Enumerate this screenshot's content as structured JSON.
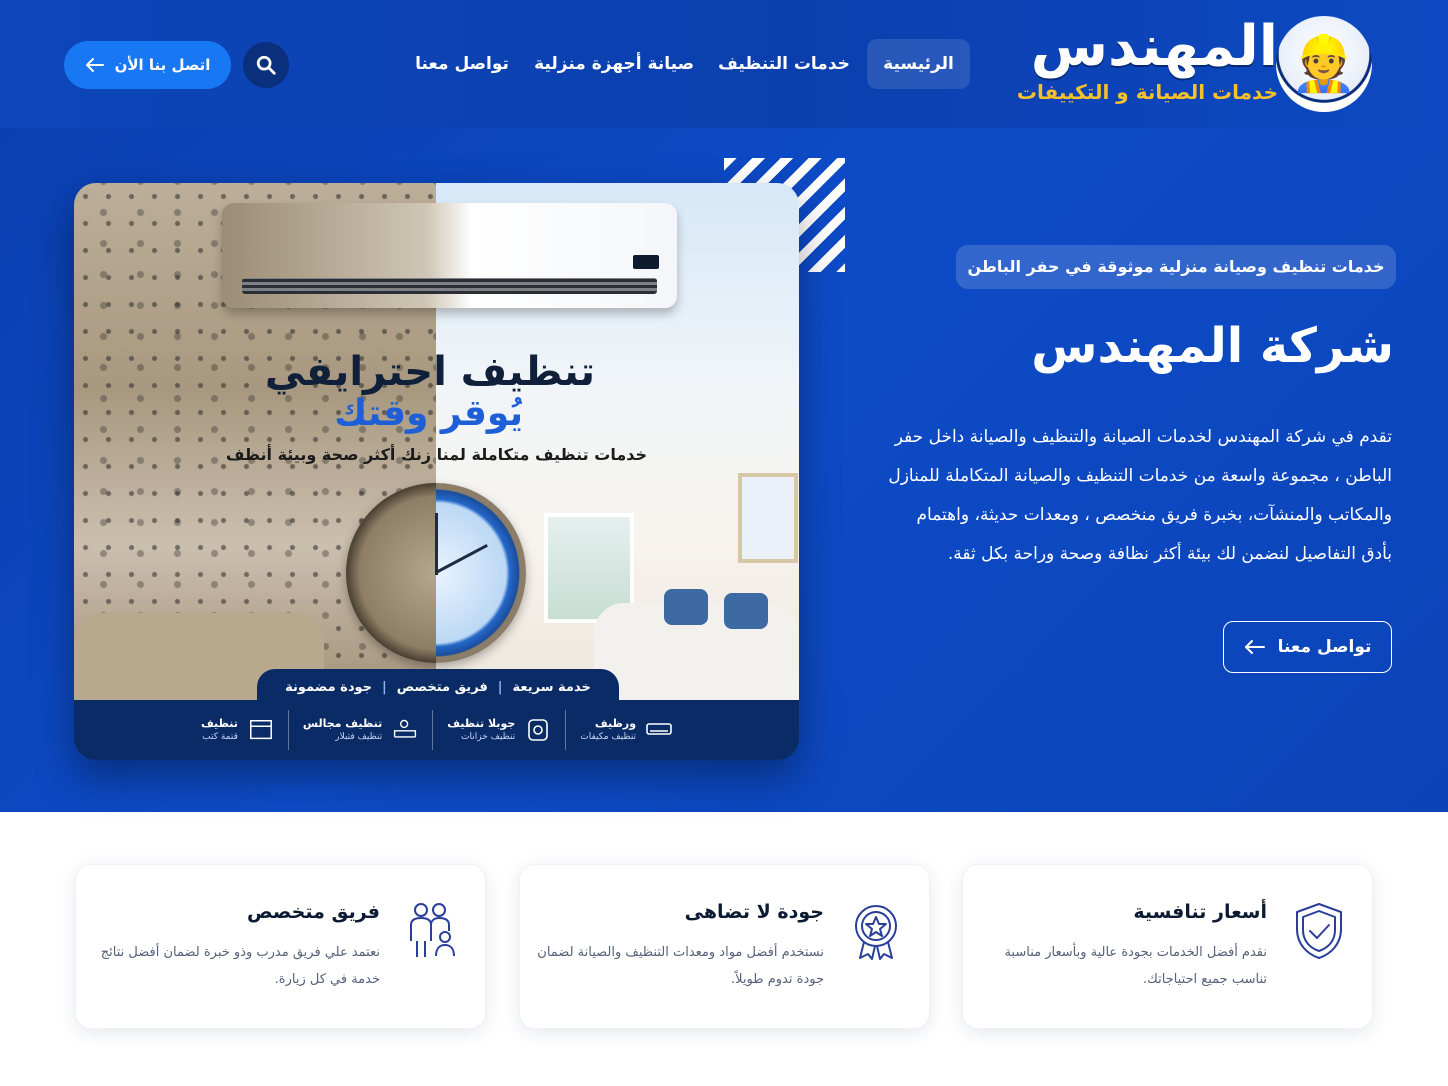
{
  "brand": {
    "name": "المهندس",
    "tagline": "خدمات الصيانة و التكييفات"
  },
  "nav": {
    "items": [
      {
        "label": "الرئيسية",
        "active": true
      },
      {
        "label": "خدمات التنظيف",
        "active": false
      },
      {
        "label": "صيانة أجهزة منزلية",
        "active": false
      },
      {
        "label": "تواصل معنا",
        "active": false
      }
    ],
    "search_icon": "search-icon",
    "cta_label": "اتصل بنا الأن"
  },
  "hero": {
    "tag": "خدمات تنظيف وصيانة منزلية موثوقة في حفر الباطن",
    "title": "شركة المهندس",
    "description": "تقدم في شركة المهندس لخدمات الصيانة والتنظيف والصيانة داخل حفر الباطن ، مجموعة واسعة من خدمات التنظيف والصيانة المتكاملة للمنازل والمكاتب والمنشآت، بخبرة فريق منخصص ، ومعدات حديثة، واهتمام بأدق التفاصيل لنضمن لك بيئة أكثر نظافة وصحة وراحة بكل ثقة.",
    "button_label": "تواصل معنا"
  },
  "promo": {
    "title": "تنظيف احترايفي",
    "subtitle": "يُوقر وقتك",
    "line": "خدمات تنظيف متكاملة لمنا زنك أكثر صحة وبيئة أنظف",
    "badges": [
      "خدمة سريعة",
      "فريق متخصص",
      "جودة مضمونة"
    ],
    "services": [
      {
        "title": "ورظيف",
        "sub": "تنظيف مكيفات",
        "icon": "ac-icon"
      },
      {
        "title": "جوبلا تنظيف",
        "sub": "تنظيف خزانات",
        "icon": "tank-icon"
      },
      {
        "title": "تنظيف مجالس",
        "sub": "تنظيف فتبلار",
        "icon": "sofa-icon"
      },
      {
        "title": "تنظيف",
        "sub": "قتمة كتب",
        "icon": "bed-icon"
      }
    ]
  },
  "features": [
    {
      "title": "أسعار تنافسية",
      "text": "نقدم أفضل الخدمات بجودة عالية وبأسعار مناسبة تناسب جميع احتياجاتك.",
      "icon": "shield-check-icon"
    },
    {
      "title": "جودة لا تضاهى",
      "text": "نستخدم أفضل مواد ومعدات التنظيف والصيانة لضمان جودة تدوم طويلاً.",
      "icon": "award-badge-icon"
    },
    {
      "title": "فريق متخصص",
      "text": "نعتمد علي فريق مدرب وذو خبرة لضمان أفضل نتائج خدمة في كل زيارة.",
      "icon": "team-icon"
    }
  ],
  "colors": {
    "primary": "#0c46b9",
    "cta": "#1877f2",
    "gold": "#f6c02b",
    "navy": "#0b2b66"
  }
}
